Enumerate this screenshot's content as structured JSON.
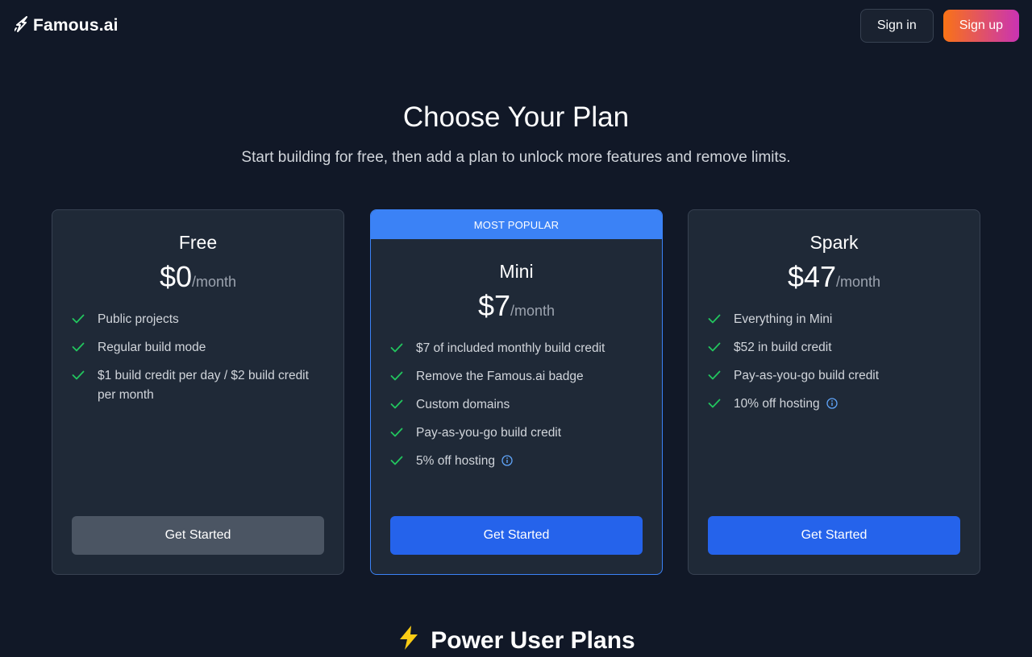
{
  "brand": {
    "name": "Famous.ai"
  },
  "nav": {
    "sign_in": "Sign in",
    "sign_up": "Sign up"
  },
  "hero": {
    "title": "Choose Your Plan",
    "subtitle": "Start building for free, then add a plan to unlock more features and remove limits."
  },
  "plans": [
    {
      "name": "Free",
      "price": "$0",
      "period": "/month",
      "features": [
        "Public projects",
        "Regular build mode",
        "$1 build credit per day / $2 build credit per month"
      ],
      "cta": "Get Started"
    },
    {
      "badge": "MOST POPULAR",
      "name": "Mini",
      "price": "$7",
      "period": "/month",
      "features": [
        "$7 of included monthly build credit",
        "Remove the Famous.ai badge",
        "Custom domains",
        "Pay-as-you-go build credit",
        "5% off hosting"
      ],
      "cta": "Get Started"
    },
    {
      "name": "Spark",
      "price": "$47",
      "period": "/month",
      "features": [
        "Everything in Mini",
        "$52 in build credit",
        "Pay-as-you-go build credit",
        "10% off hosting"
      ],
      "cta": "Get Started"
    }
  ],
  "power": {
    "icon": "lightning-icon",
    "title": "Power User Plans"
  },
  "colors": {
    "background": "#111827",
    "card": "#1f2937",
    "accent_blue": "#2563eb",
    "popular_blue": "#3b82f6",
    "check_green": "#22c55e",
    "signup_gradient_start": "#f97316",
    "signup_gradient_end": "#c026d3"
  }
}
